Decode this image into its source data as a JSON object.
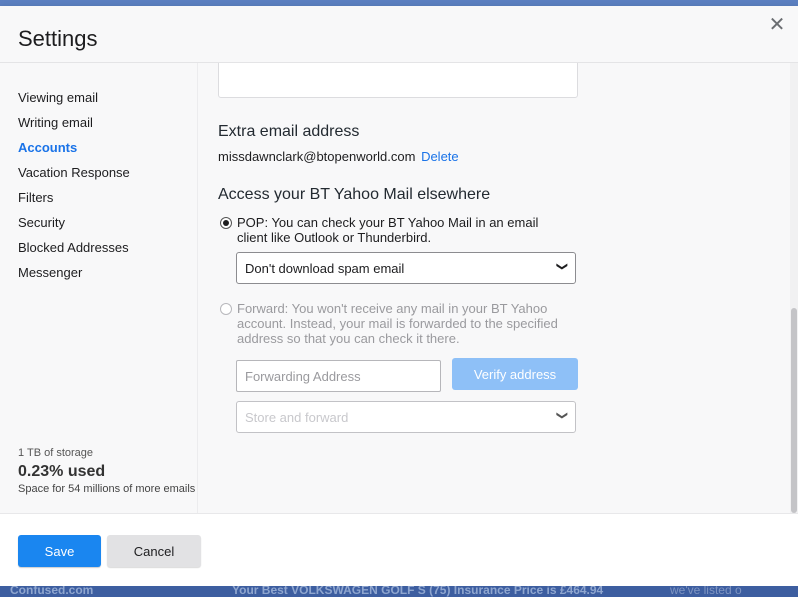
{
  "dialog": {
    "title": "Settings",
    "close_icon": "close-icon"
  },
  "sidebar": {
    "items": [
      {
        "label": "Viewing email",
        "active": false
      },
      {
        "label": "Writing email",
        "active": false
      },
      {
        "label": "Accounts",
        "active": true
      },
      {
        "label": "Vacation Response",
        "active": false
      },
      {
        "label": "Filters",
        "active": false
      },
      {
        "label": "Security",
        "active": false
      },
      {
        "label": "Blocked Addresses",
        "active": false
      },
      {
        "label": "Messenger",
        "active": false
      }
    ],
    "storage": {
      "capacity": "1 TB of storage",
      "used": "0.23% used",
      "space_note": "Space for 54 millions of more emails"
    }
  },
  "content": {
    "extra_email": {
      "heading": "Extra email address",
      "address": "missdawnclark@btopenworld.com",
      "delete_label": "Delete"
    },
    "access": {
      "heading": "Access your BT Yahoo Mail elsewhere",
      "pop": {
        "label": "POP: You can check your BT Yahoo Mail in an email client like Outlook or Thunderbird.",
        "selected": true,
        "select_value": "Don't download spam email"
      },
      "forward": {
        "label": "Forward: You won't receive any mail in your BT Yahoo account. Instead, your mail is forwarded to the specified address so that you can check it there.",
        "selected": false,
        "address_placeholder": "Forwarding Address",
        "verify_label": "Verify address",
        "select_value": "Store and forward"
      }
    }
  },
  "footer": {
    "save_label": "Save",
    "cancel_label": "Cancel"
  },
  "background": {
    "ad_brand": "Confused.com",
    "ad_text": "Your Best VOLKSWAGEN GOLF S (75) Insurance Price is £464.94",
    "ad_tail": "we've listed o"
  },
  "colors": {
    "accent": "#1a86f0",
    "link": "#1a73e8",
    "verify_disabled": "#8ec0f7"
  }
}
